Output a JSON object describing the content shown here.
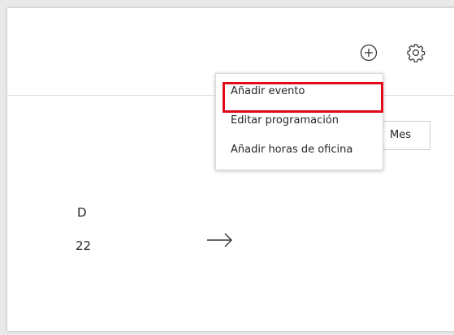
{
  "header": {
    "add_icon": "plus-circle-icon",
    "settings_icon": "gear-icon"
  },
  "menu": {
    "items": [
      {
        "label": "Añadir evento"
      },
      {
        "label": "Editar programación"
      },
      {
        "label": "Añadir horas de oficina"
      }
    ],
    "highlighted_index": 0
  },
  "view_selector": {
    "label": "Mes"
  },
  "calendar": {
    "day_letter": "D",
    "day_number": "22",
    "next_icon": "arrow-right-icon"
  },
  "colors": {
    "highlight": "#e3071a",
    "text": "#262626",
    "divider": "#dcdcdc"
  }
}
